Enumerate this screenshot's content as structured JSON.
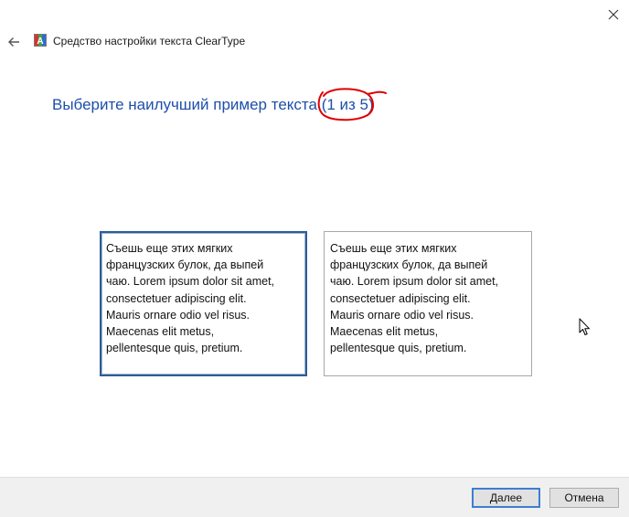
{
  "window": {
    "title": "Средство настройки текста ClearType",
    "close_icon": "close-icon",
    "back_icon": "back-arrow-icon",
    "app_icon": "cleartype-app-icon"
  },
  "main": {
    "heading": "Выберите наилучший пример текста",
    "progress": "(1 из 5)",
    "annotation_color": "#e00000",
    "heading_color": "#1d4faa"
  },
  "samples": [
    {
      "lines": [
        "Съешь еще этих мягких",
        "французских булок, да выпей",
        "чаю. Lorem ipsum dolor sit amet,",
        "consectetuer adipiscing elit.",
        "Mauris ornare odio vel risus.",
        "Maecenas elit metus,",
        "pellentesque quis, pretium."
      ],
      "selected": true
    },
    {
      "lines": [
        "Съешь еще этих мягких",
        "французских булок, да выпей",
        "чаю. Lorem ipsum dolor sit amet,",
        "consectetuer adipiscing elit.",
        "Mauris ornare odio vel risus.",
        "Maecenas elit metus,",
        "pellentesque quis, pretium."
      ],
      "selected": false
    }
  ],
  "footer": {
    "next_label": "Далее",
    "cancel_label": "Отмена"
  }
}
